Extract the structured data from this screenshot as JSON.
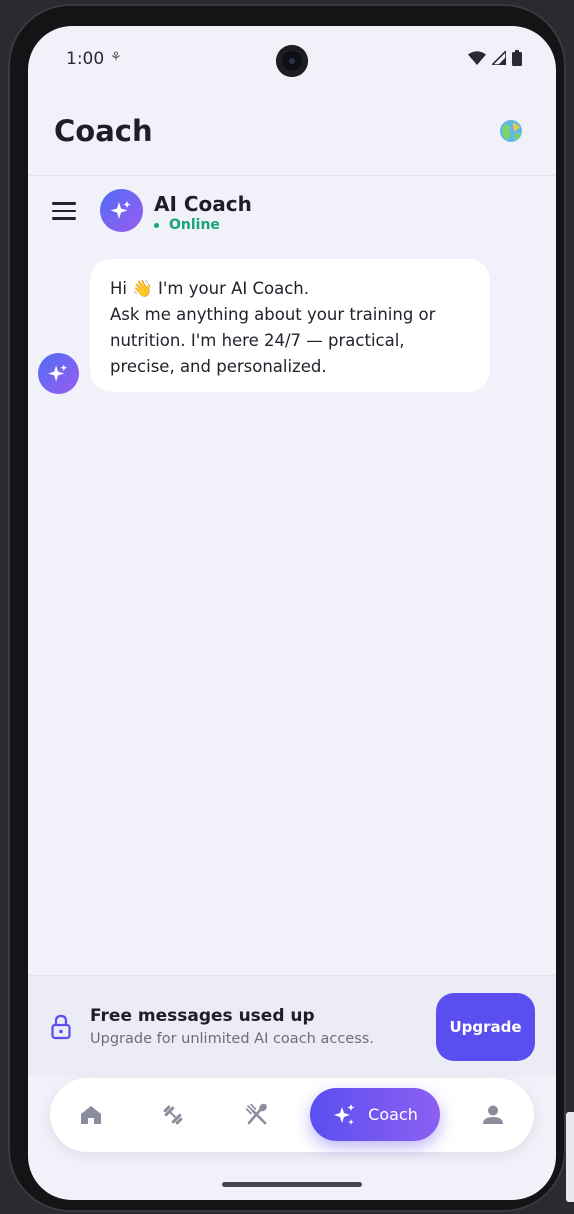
{
  "status_bar": {
    "time": "1:00",
    "note_icon": "media-note-icon",
    "icons": [
      "wifi-icon",
      "signal-icon",
      "battery-icon"
    ]
  },
  "header": {
    "title": "Coach",
    "right_icon": "globe-icon"
  },
  "chat_header": {
    "name": "AI Coach",
    "status": "Online"
  },
  "messages": [
    {
      "from": "coach",
      "lines": [
        "Hi 👋 I'm your AI Coach.",
        "Ask me anything about your training or",
        "nutrition. I'm here 24/7 — practical,",
        "precise, and personalized."
      ]
    }
  ],
  "upgrade": {
    "title": "Free messages used up",
    "subtitle": "Upgrade for unlimited AI coach access.",
    "button_label": "Upgrade"
  },
  "bottom_nav": {
    "items": [
      "home-icon",
      "dumbbell-icon",
      "fork-knife-icon",
      "coach-sparkle-icon",
      "profile-icon"
    ],
    "active_label": "Coach"
  },
  "colors": {
    "accent": "#5b4ef0",
    "online": "#1aa476",
    "background": "#f1f1f9"
  }
}
